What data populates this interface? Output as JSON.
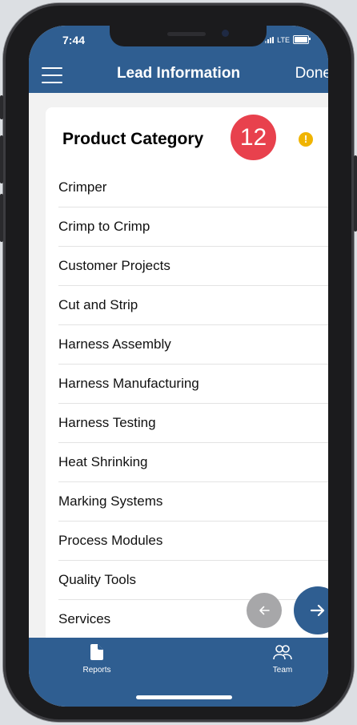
{
  "status_bar": {
    "time": "7:44",
    "carrier": "LTE"
  },
  "nav": {
    "title": "Lead Information",
    "done_label": "Done"
  },
  "card": {
    "title": "Product Category",
    "step_number": "12",
    "warning_symbol": "!",
    "categories": [
      "Crimper",
      "Crimp to Crimp",
      "Customer Projects",
      "Cut and Strip",
      "Harness Assembly",
      "Harness Manufacturing",
      "Harness Testing",
      "Heat Shrinking",
      "Marking Systems",
      "Process Modules",
      "Quality Tools",
      "Services"
    ]
  },
  "tabs": [
    {
      "label": "Reports",
      "icon": "document-icon"
    },
    {
      "label": "Team",
      "icon": "people-icon"
    }
  ],
  "fab": {
    "back_icon": "arrow-left-icon",
    "next_icon": "arrow-right-icon"
  },
  "colors": {
    "brand_blue": "#2f5e91",
    "badge_red": "#e8414d",
    "warning_yellow": "#f0b400",
    "back_button_gray": "#a7a7a9"
  }
}
